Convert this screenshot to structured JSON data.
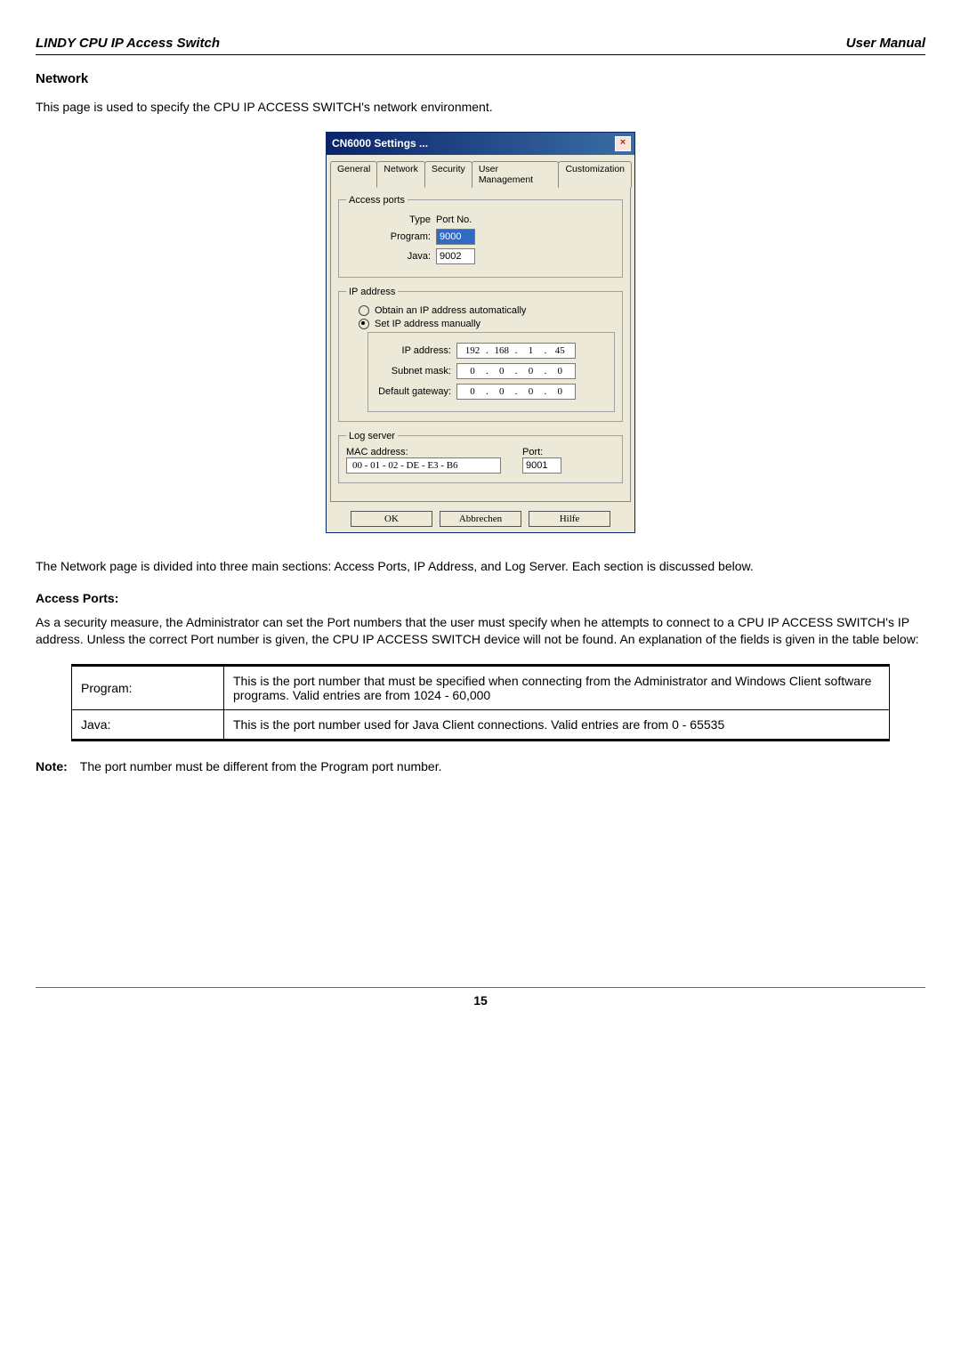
{
  "header": {
    "left": "LINDY CPU IP Access Switch",
    "right": "User Manual"
  },
  "section_title": "Network",
  "intro": "This page is used to specify the CPU IP ACCESS SWITCH's network environment.",
  "dialog": {
    "title": "CN6000 Settings ...",
    "tabs": [
      "General",
      "Network",
      "Security",
      "User Management",
      "Customization"
    ],
    "active_tab": "Network",
    "access_ports": {
      "legend": "Access ports",
      "type_header": "Type",
      "port_header": "Port No.",
      "program_label": "Program:",
      "program_value": "9000",
      "java_label": "Java:",
      "java_value": "9002"
    },
    "ip": {
      "legend": "IP address",
      "auto_label": "Obtain an IP address automatically",
      "manual_label": "Set IP address manually",
      "manual_checked": true,
      "ip_label": "IP address:",
      "ip_value": [
        "192",
        "168",
        "1",
        "45"
      ],
      "mask_label": "Subnet mask:",
      "mask_value": [
        "0",
        "0",
        "0",
        "0"
      ],
      "gw_label": "Default gateway:",
      "gw_value": [
        "0",
        "0",
        "0",
        "0"
      ]
    },
    "log": {
      "legend": "Log server",
      "mac_label": "MAC address:",
      "mac_value": "00 - 01 - 02 - DE - E3 - B6",
      "port_label": "Port:",
      "port_value": "9001"
    },
    "buttons": {
      "ok": "OK",
      "cancel": "Abbrechen",
      "help": "Hilfe"
    }
  },
  "para2": "The Network page is divided into three main sections: Access Ports, IP Address, and Log Server. Each section is discussed below.",
  "access_ports_heading": "Access Ports:",
  "para3": "As a security measure, the Administrator can set the Port numbers that the user must specify when he attempts to connect to a CPU IP ACCESS SWITCH's IP address. Unless the correct Port number is given, the CPU IP ACCESS SWITCH device will not be found. An explanation of the fields is given in the table below:",
  "ports_table": {
    "rows": [
      {
        "k": "Program:",
        "v": "This is the port number that must be specified when connecting from the Administrator and Windows Client software programs. Valid entries are from 1024 - 60,000"
      },
      {
        "k": "Java:",
        "v": "This is the port number used for Java Client connections. Valid entries are from 0 - 65535"
      }
    ]
  },
  "note_label": "Note:",
  "note_text": "The port number must be different from the Program port number.",
  "page_number": "15"
}
